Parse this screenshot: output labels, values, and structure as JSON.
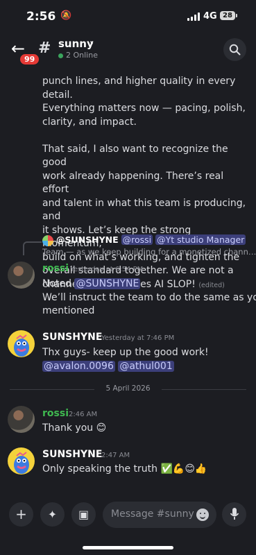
{
  "status": {
    "time": "2:56",
    "network": "4G",
    "battery": "28"
  },
  "header": {
    "unread_badge": "99",
    "channel_name": "sunny",
    "chevron": "›",
    "online": "2 Online"
  },
  "chat": {
    "top_message_lines": [
      "punch lines, and higher quality in every detail.",
      "Everything matters now — pacing, polish,",
      "clarity, and impact.",
      "",
      "That said, I also want to recognize the good",
      "work already happening. There’s real effort",
      "and talent in what this team is producing, and",
      "it shows. Let’s keep the strong momentum,",
      "build on what’s working, and tighten the",
      "overall standard together. We are not a"
    ],
    "top_message_last_line": "channel that produces AI SLOP!",
    "edited_tag": "(edited)",
    "reply": {
      "author": "@SUNSHYNE",
      "mention1": "@rossi",
      "mention2": "@Yt studio Manager",
      "preview": "Team — as we keep building for a monetized chann…"
    },
    "messages": [
      {
        "author": "rossi",
        "time": "Yesterday at 6:54 PM",
        "mention": "@SUNSHYNE",
        "line1_prefix": "Noted ",
        "line2": "We’ll instruct the team to do the same as you",
        "line3": "mentioned"
      },
      {
        "author": "SUNSHYNE",
        "time": "Yesterday at 7:46 PM",
        "line1": "Thx guys- keep up the good work!",
        "mention1": "@avalon.0096",
        "mention2": "@athul001"
      },
      {
        "author": "rossi",
        "time": "2:46 AM",
        "text": "Thank you 😊"
      },
      {
        "author": "SUNSHYNE",
        "time": "2:47 AM",
        "text": "Only speaking the truth ✅💪😊👍"
      }
    ],
    "date_divider": "5 April 2026"
  },
  "composer": {
    "placeholder": "Message #sunny"
  },
  "colors": {
    "background": "#1c1d22",
    "mention_bg": "#3c3f7a",
    "online_green": "#3ba55d",
    "badge_red": "#e53935"
  }
}
